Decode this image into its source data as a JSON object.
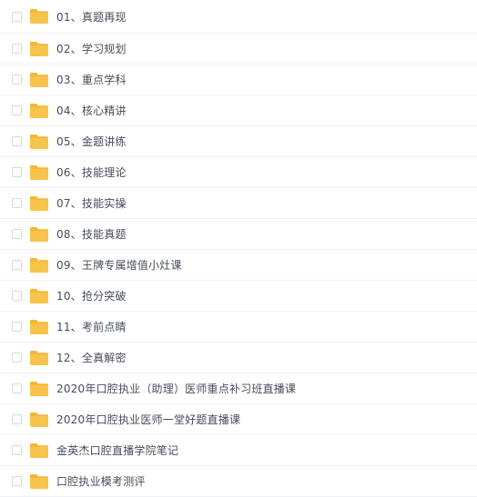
{
  "folder_color": "#f8c34b",
  "folder_tab_color": "#f4b736",
  "items": [
    {
      "name": "01、真题再现",
      "icon": "folder-icon"
    },
    {
      "name": "02、学习规划",
      "icon": "folder-icon"
    },
    {
      "name": "03、重点学科",
      "icon": "folder-icon"
    },
    {
      "name": "04、核心精讲",
      "icon": "folder-icon"
    },
    {
      "name": "05、金题讲练",
      "icon": "folder-icon"
    },
    {
      "name": "06、技能理论",
      "icon": "folder-icon"
    },
    {
      "name": "07、技能实操",
      "icon": "folder-icon"
    },
    {
      "name": "08、技能真题",
      "icon": "folder-icon"
    },
    {
      "name": "09、王牌专属增值小灶课",
      "icon": "folder-icon"
    },
    {
      "name": "10、抢分突破",
      "icon": "folder-icon"
    },
    {
      "name": "11、考前点睛",
      "icon": "folder-icon"
    },
    {
      "name": "12、全真解密",
      "icon": "folder-icon"
    },
    {
      "name": "2020年口腔执业（助理）医师重点补习班直播课",
      "icon": "folder-icon"
    },
    {
      "name": "2020年口腔执业医师一堂好题直播课",
      "icon": "folder-icon"
    },
    {
      "name": "金英杰口腔直播学院笔记",
      "icon": "folder-icon"
    },
    {
      "name": "口腔执业模考测评",
      "icon": "folder-icon"
    }
  ]
}
